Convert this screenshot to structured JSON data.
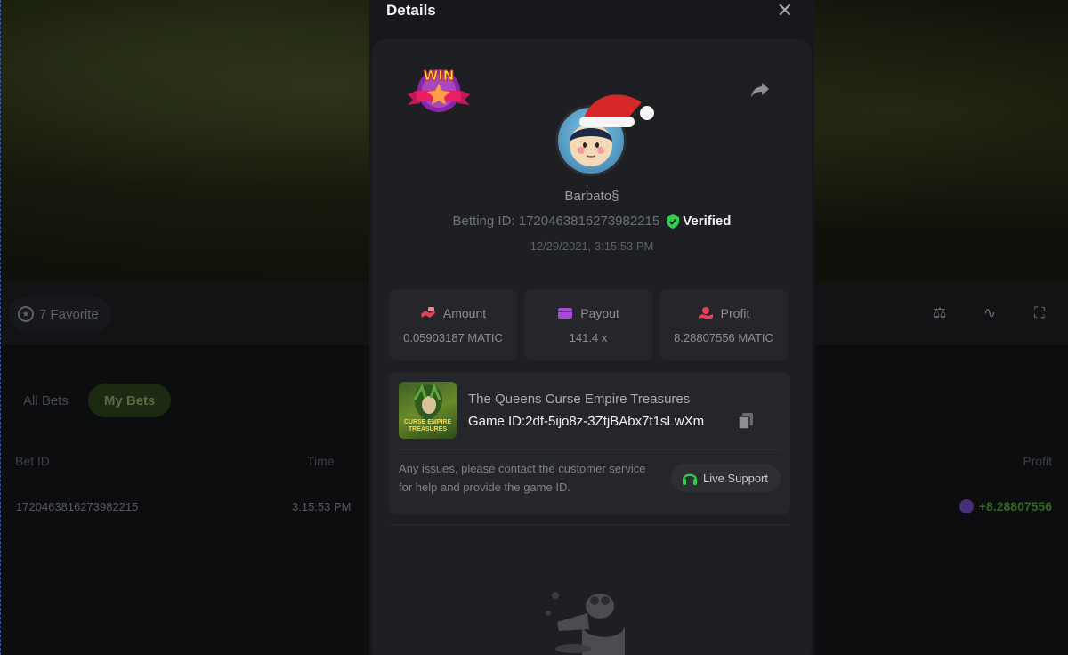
{
  "background": {
    "favorite": {
      "label": "7 Favorite",
      "icon": "star-icon"
    },
    "toolbar_icons": [
      "balance-icon",
      "trend-icon",
      "fullscreen-icon"
    ],
    "tabs": [
      {
        "label": "All Bets",
        "active": false
      },
      {
        "label": "My Bets",
        "active": true
      }
    ],
    "columns": {
      "bet_id": "Bet ID",
      "time": "Time",
      "profit": "Profit"
    },
    "row": {
      "bet_id": "1720463816273982215",
      "time": "3:15:53 PM",
      "profit": "+8.28807556"
    }
  },
  "modal": {
    "title": "Details",
    "username": "Barbato§",
    "betting_id": "Betting ID: 1720463816273982215",
    "verified_label": "Verified",
    "timestamp": "12/29/2021, 3:15:53 PM",
    "stats": [
      {
        "label": "Amount",
        "value": "0.05903187 MATIC",
        "icon": "amount-icon",
        "color": "#e8415a"
      },
      {
        "label": "Payout",
        "value": "141.4 x",
        "icon": "card-icon",
        "color": "#a64bd8"
      },
      {
        "label": "Profit",
        "value": "8.28807556 MATIC",
        "icon": "profit-icon",
        "color": "#e8415a"
      }
    ],
    "game": {
      "name": "The Queens Curse Empire Treasures",
      "game_id": "Game ID:2df-5ijo8z-3ZtjBAbx7t1sLwXm",
      "thumb_text": "CURSE EMPIRE TREASURES"
    },
    "issue_text": "Any issues, please contact the customer service for help and provide the game ID.",
    "support_label": "Live Support",
    "colors": {
      "verified": "#2fce4c",
      "support_icon": "#2fce4c"
    }
  }
}
